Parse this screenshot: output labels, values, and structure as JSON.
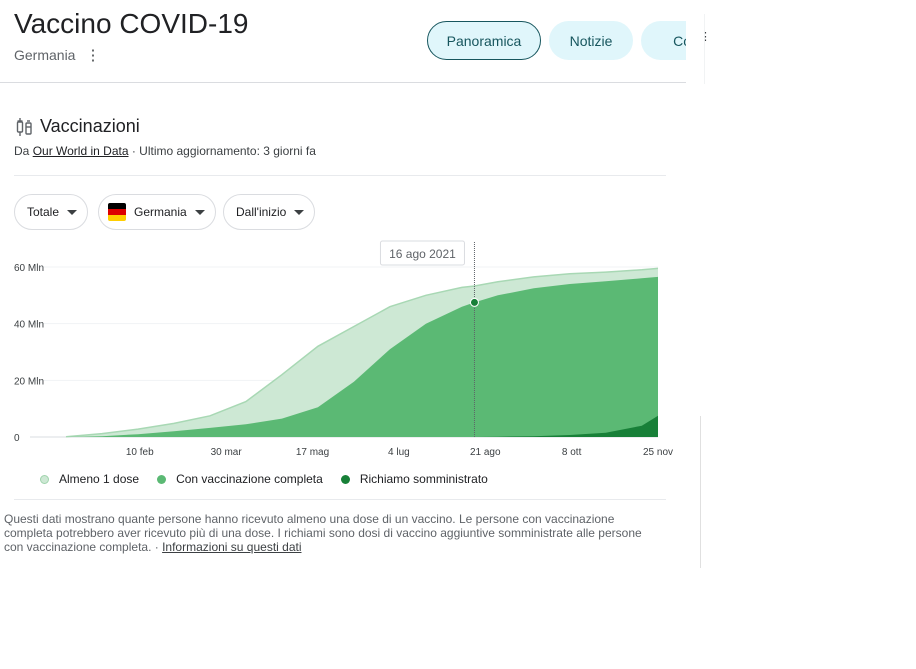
{
  "header": {
    "title": "Vaccino COVID-19",
    "subtitle": "Germania",
    "tabs": [
      "Panoramica",
      "Notizie",
      "Con"
    ]
  },
  "section": {
    "title": "Vaccinazioni",
    "source_prefix": "Da",
    "source_link": "Our World in Data",
    "updated": "· Ultimo aggiornamento: 3 giorni fa"
  },
  "filters": {
    "metric": "Totale",
    "country": "Germania",
    "range": "Dall'inizio"
  },
  "colors": {
    "at_least_one": "#cde8d4",
    "fully": "#5bb974",
    "booster": "#188038",
    "accent": "#17565e",
    "flag": [
      "#000000",
      "#dd0000",
      "#ffce00"
    ]
  },
  "chart_data": {
    "type": "area",
    "tooltip": "16 ago 2021",
    "y_ticks": [
      "60 Mln",
      "40 Mln",
      "20 Mln",
      "0"
    ],
    "y_tick_values": [
      60,
      40,
      20,
      0
    ],
    "x_ticks": [
      "10 feb",
      "30 mar",
      "17 mag",
      "4 lug",
      "21 ago",
      "8 ott",
      "25 nov"
    ],
    "x_tick_days": [
      41,
      89,
      137,
      185,
      233,
      281,
      329
    ],
    "ylim": [
      0,
      60
    ],
    "xlim_days": [
      0,
      329
    ],
    "highlight_day": 227,
    "x_days": [
      0,
      20,
      40,
      60,
      80,
      100,
      120,
      140,
      160,
      180,
      200,
      220,
      227,
      240,
      260,
      280,
      300,
      320,
      329
    ],
    "series": [
      {
        "name": "Almeno 1 dose",
        "values": [
          0.1,
          1.2,
          2.8,
          4.8,
          7.5,
          12.5,
          22,
          32,
          39,
          46,
          50,
          52.8,
          53.3,
          54.8,
          56.5,
          57.6,
          58.2,
          59,
          59.5
        ]
      },
      {
        "name": "Con vaccinazione completa",
        "values": [
          0,
          0.3,
          1.0,
          2.0,
          3.2,
          4.5,
          6.5,
          10.5,
          19.5,
          31,
          40,
          46,
          47.5,
          50,
          52.5,
          54,
          55,
          56,
          56.5
        ]
      },
      {
        "name": "Richiamo somministrato",
        "values": [
          0,
          0,
          0,
          0,
          0,
          0,
          0,
          0,
          0,
          0,
          0,
          0,
          0,
          0.1,
          0.3,
          0.7,
          1.5,
          4.0,
          7.5
        ]
      }
    ]
  },
  "legend": [
    "Almeno 1 dose",
    "Con vaccinazione completa",
    "Richiamo somministrato"
  ],
  "note": {
    "text": "Questi dati mostrano quante persone hanno ricevuto almeno una dose di un vaccino. Le persone con vaccinazione completa potrebbero aver ricevuto più di una dose. I richiami sono dosi di vaccino aggiuntive somministrate alle persone con vaccinazione completa.",
    "separator": " · ",
    "link": "Informazioni su questi dati"
  }
}
